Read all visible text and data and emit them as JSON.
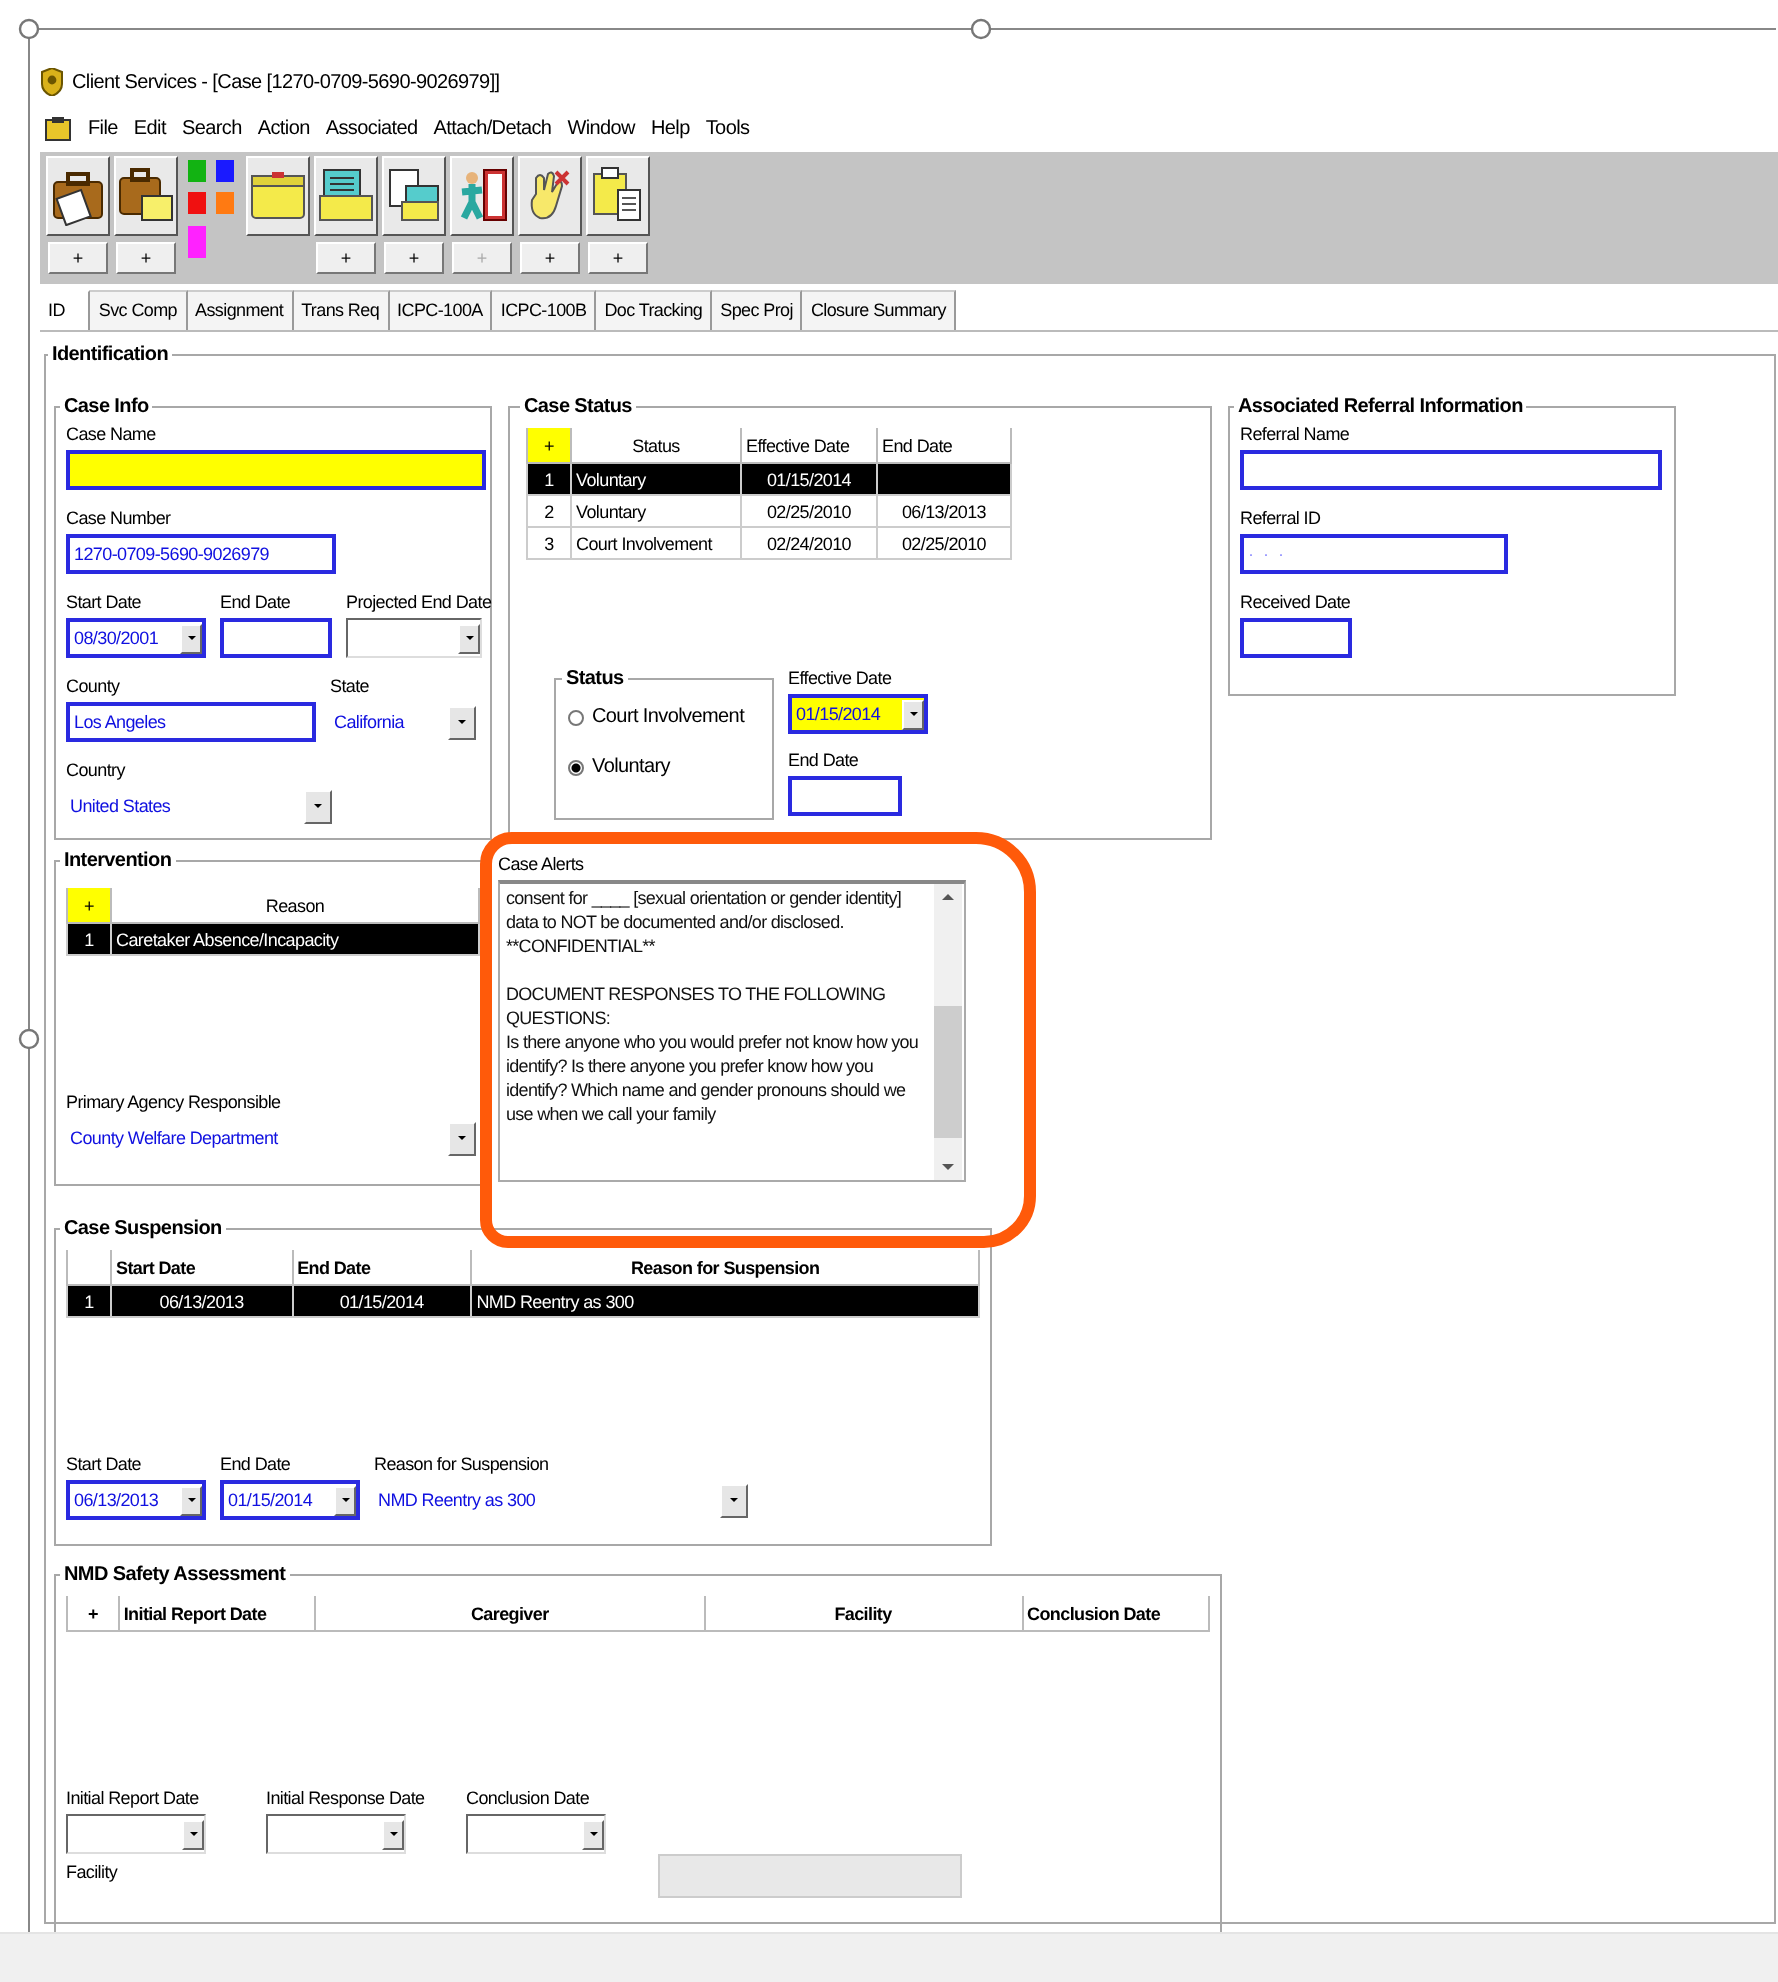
{
  "window": {
    "title": "Client Services - [Case [1270-0709-5690-9026979]]"
  },
  "menu": [
    "File",
    "Edit",
    "Search",
    "Action",
    "Associated",
    "Attach/Detach",
    "Window",
    "Help",
    "Tools"
  ],
  "toolbar": [
    {
      "kind": "button",
      "plus": "+",
      "disabled": false
    },
    {
      "kind": "button",
      "plus": "+",
      "disabled": false
    },
    {
      "kind": "palette"
    },
    {
      "kind": "button"
    },
    {
      "kind": "button",
      "plus": "+",
      "disabled": false
    },
    {
      "kind": "button",
      "plus": "+",
      "disabled": false
    },
    {
      "kind": "button",
      "plus": "+",
      "disabled": true
    },
    {
      "kind": "button",
      "plus": "+",
      "disabled": false
    },
    {
      "kind": "button",
      "plus": "+",
      "disabled": false
    }
  ],
  "tabs": [
    {
      "label": "ID",
      "selected": true
    },
    {
      "label": "Svc Comp",
      "selected": false
    },
    {
      "label": "Assignment",
      "selected": false
    },
    {
      "label": "Trans Req",
      "selected": false
    },
    {
      "label": "ICPC-100A",
      "selected": false
    },
    {
      "label": "ICPC-100B",
      "selected": false
    },
    {
      "label": "Doc Tracking",
      "selected": false
    },
    {
      "label": "Spec Proj",
      "selected": false
    },
    {
      "label": "Closure Summary",
      "selected": false
    }
  ],
  "identification": {
    "title": "Identification",
    "case_info": {
      "title": "Case Info",
      "fields": [
        {
          "label": "Case Name",
          "kind": "text",
          "required": true
        },
        {
          "label": "Case Number",
          "kind": "text",
          "value": "1270-0709-5690-9026979",
          "required": false
        },
        {
          "label": "Start Date",
          "kind": "date",
          "value": "08/30/2001",
          "required": false
        },
        {
          "label": "End Date",
          "kind": "text",
          "required": false
        },
        {
          "label": "Projected End Date",
          "kind": "combo",
          "required": false
        },
        {
          "label": "County",
          "kind": "text",
          "value": "Los Angeles",
          "required": false
        },
        {
          "label": "State",
          "kind": "select",
          "value": "California",
          "required": false
        },
        {
          "label": "Country",
          "kind": "select",
          "value": "United States",
          "required": false
        }
      ]
    },
    "intervention": {
      "title": "Intervention",
      "table": {
        "columns": [
          {
            "label": "+",
            "kind": "add",
            "required": true
          },
          {
            "label": "Reason",
            "kind": "text"
          }
        ],
        "rows": [
          {
            "cells": [
              "1",
              "Caretaker Absence/Incapacity"
            ],
            "selected": true
          }
        ]
      },
      "fields": [
        {
          "label": "Primary Agency Responsible",
          "kind": "select",
          "value": "County Welfare Department",
          "required": false
        }
      ]
    },
    "case_status": {
      "title": "Case Status",
      "table": {
        "columns": [
          {
            "label": "+",
            "kind": "add",
            "required": true
          },
          {
            "label": "Status",
            "kind": "text"
          },
          {
            "label": "Effective Date",
            "kind": "date"
          },
          {
            "label": "End Date",
            "kind": "date"
          }
        ],
        "rows": [
          {
            "cells": [
              "1",
              "Voluntary",
              "01/15/2014"
            ],
            "selected": true
          },
          {
            "cells": [
              "2",
              "Voluntary",
              "02/25/2010",
              "06/13/2013"
            ],
            "selected": false
          },
          {
            "cells": [
              "3",
              "Court Involvement",
              "02/24/2010",
              "02/25/2010"
            ],
            "selected": false
          }
        ]
      },
      "status": {
        "title": "Status",
        "options": [
          {
            "label": "Court Involvement",
            "selected": false
          },
          {
            "label": "Voluntary",
            "selected": true
          }
        ]
      },
      "fields": [
        {
          "label": "Effective Date",
          "kind": "date",
          "value": "01/15/2014",
          "required": true
        },
        {
          "label": "End Date",
          "kind": "text",
          "required": false
        }
      ]
    },
    "case_alerts": {
      "label": "Case Alerts",
      "text": "consent for ____ [sexual orientation or gender identity] data to NOT be documented and/or disclosed. **CONFIDENTIAL**\n\nDOCUMENT RESPONSES TO THE FOLLOWING QUESTIONS:\nIs there anyone who you would prefer not know how you identify? Is there anyone you prefer know how you identify? Which name and gender pronouns should we use when we call your family"
    },
    "associated_referral": {
      "title": "Associated Referral Information",
      "fields": [
        {
          "label": "Referral Name",
          "kind": "text",
          "required": false
        },
        {
          "label": "Referral ID",
          "kind": "text",
          "placeholder": "·   ·   ·",
          "required": false
        },
        {
          "label": "Received Date",
          "kind": "text",
          "required": false
        }
      ]
    },
    "case_suspension": {
      "title": "Case Suspension",
      "table": {
        "columns": [
          {
            "kind": "index"
          },
          {
            "label": "Start Date",
            "kind": "date"
          },
          {
            "label": "End Date",
            "kind": "date"
          },
          {
            "label": "Reason for Suspension",
            "kind": "text"
          }
        ],
        "rows": [
          {
            "cells": [
              "1",
              "06/13/2013",
              "01/15/2014",
              "NMD Reentry as 300"
            ],
            "selected": true
          }
        ]
      },
      "fields": [
        {
          "label": "Start Date",
          "kind": "date",
          "value": "06/13/2013",
          "required": false
        },
        {
          "label": "End Date",
          "kind": "date",
          "value": "01/15/2014",
          "required": false
        },
        {
          "label": "Reason for Suspension",
          "kind": "select",
          "value": "NMD Reentry as 300",
          "required": false
        }
      ]
    },
    "nmd_safety_assessment": {
      "title": "NMD Safety Assessment",
      "table": {
        "columns": [
          {
            "label": "+",
            "kind": "add",
            "required": false
          },
          {
            "label": "Initial Report Date",
            "kind": "date"
          },
          {
            "label": "Caregiver",
            "kind": "text"
          },
          {
            "label": "Facility",
            "kind": "text"
          },
          {
            "label": "Conclusion Date",
            "kind": "date"
          }
        ]
      },
      "fields": [
        {
          "label": "Initial Report Date",
          "kind": "combo",
          "required": false
        },
        {
          "label": "Initial Response Date",
          "kind": "combo",
          "required": false
        },
        {
          "label": "Conclusion Date",
          "kind": "combo",
          "required": false
        }
      ],
      "facility_label": "Facility"
    }
  }
}
